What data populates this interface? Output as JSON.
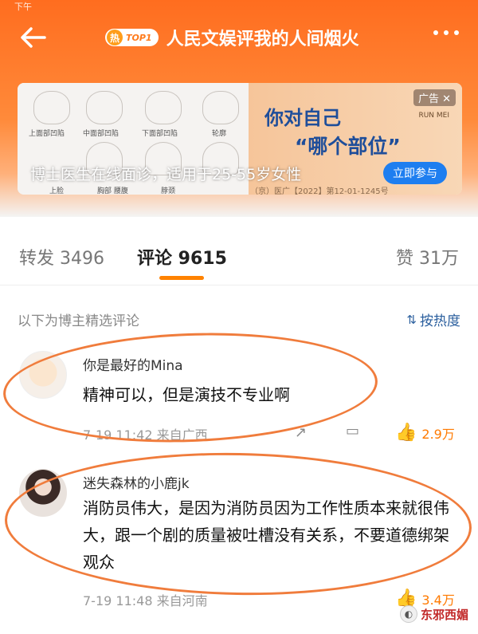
{
  "status": {
    "time": "下午"
  },
  "header": {
    "hot_badge": {
      "icon": "热",
      "rank": "TOP1"
    },
    "title": "人民文娱评我的人间烟火",
    "back_icon": "back-arrow-icon",
    "more_icon": "more-dots-icon"
  },
  "ad": {
    "tag": "广告",
    "headline_line1": "你对自己",
    "headline_line2": "“哪个部位”",
    "brand": "RUN MEI",
    "caption": "博士医生在线面诊，适用于25-55岁女性",
    "cta": "立即参与",
    "license": "（京）医广【2022】第12-01-1245号",
    "face_labels": [
      "上面部凹陷",
      "中面部凹陷",
      "下面部凹陷",
      "轮廓",
      "上脸",
      "胸部 腰腹",
      "脖颈"
    ]
  },
  "tabs": {
    "repost": "转发 3496",
    "comment": "评论 9615",
    "like": "赞 31万"
  },
  "filter": {
    "label": "以下为博主精选评论",
    "sort": "按热度",
    "sort_icon": "sort-icon"
  },
  "comments": [
    {
      "user": "你是最好的Mina",
      "text": "精神可以，但是演技不专业啊",
      "time": "7-19 11:42",
      "source": "来自广西",
      "likes": "2.9万"
    },
    {
      "user": "迷失森林的小鹿jk",
      "text": "消防员伟大，是因为消防员因为工作性质本来就很伟大，跟一个剧的质量被吐槽没有关系，不要道德绑架观众",
      "time": "7-19 11:48",
      "source": "来自河南",
      "likes": "3.4万"
    }
  ],
  "watermark": {
    "text": "东邪西媚"
  },
  "colors": {
    "accent": "#ff8200",
    "link": "#2b5f9e",
    "annotation": "#f07c3c"
  }
}
